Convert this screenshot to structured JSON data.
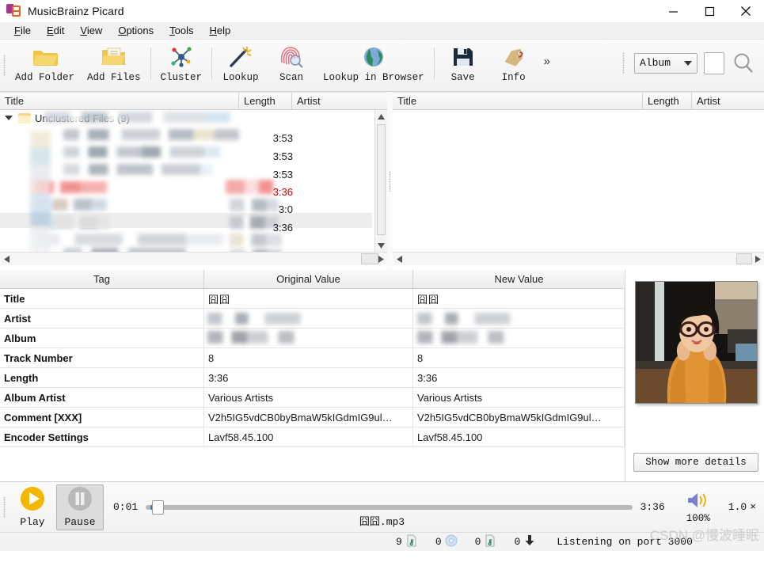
{
  "window": {
    "title": "MusicBrainz Picard",
    "icon": "picard-app-icon",
    "controls": {
      "minimize": "minimize-icon",
      "maximize": "maximize-icon",
      "close": "close-icon"
    }
  },
  "menubar": {
    "items": [
      {
        "label": "File",
        "mnemonic": "F"
      },
      {
        "label": "Edit",
        "mnemonic": "E"
      },
      {
        "label": "View",
        "mnemonic": "V"
      },
      {
        "label": "Options",
        "mnemonic": "O"
      },
      {
        "label": "Tools",
        "mnemonic": "T"
      },
      {
        "label": "Help",
        "mnemonic": "H"
      }
    ]
  },
  "toolbar": {
    "buttons": [
      {
        "label": "Add Folder",
        "icon": "folder-open-icon"
      },
      {
        "label": "Add Files",
        "icon": "file-folder-icon"
      },
      {
        "label": "Cluster",
        "icon": "cluster-network-icon"
      },
      {
        "label": "Lookup",
        "icon": "magic-wand-icon"
      },
      {
        "label": "Scan",
        "icon": "fingerprint-scan-icon"
      },
      {
        "label": "Lookup in Browser",
        "icon": "globe-icon"
      },
      {
        "label": "Save",
        "icon": "floppy-save-icon"
      },
      {
        "label": "Info",
        "icon": "tag-info-icon"
      }
    ],
    "overflow_label": "»",
    "search_type": "Album",
    "search_value": "",
    "search_icon": "search-icon"
  },
  "left_pane": {
    "columns": [
      "Title",
      "Length",
      "Artist"
    ],
    "root_node": {
      "label": "Unclustered Files (9)",
      "expanded": true,
      "icon": "folder-icon"
    },
    "durations": [
      "3:53",
      "3:53",
      "3:53",
      "3:36",
      "3:0",
      "3:36"
    ],
    "duration_error_index": 3,
    "censored": true
  },
  "right_pane": {
    "columns": [
      "Title",
      "Length",
      "Artist"
    ],
    "rows": []
  },
  "tag_table": {
    "headers": [
      "Tag",
      "Original Value",
      "New Value"
    ],
    "rows": [
      {
        "tag": "Title",
        "original": "囧囧",
        "new": "囧囧",
        "censored": false
      },
      {
        "tag": "Artist",
        "original": "",
        "new": "",
        "censored": true
      },
      {
        "tag": "Album",
        "original": "",
        "new": "",
        "censored": true
      },
      {
        "tag": "Track Number",
        "original": "8",
        "new": "8",
        "censored": false
      },
      {
        "tag": "Length",
        "original": "3:36",
        "new": "3:36",
        "censored": false
      },
      {
        "tag": "Album Artist",
        "original": "Various Artists",
        "new": "Various Artists",
        "censored": false
      },
      {
        "tag": "Comment [XXX]",
        "original": "V2h5IG5vdCB0byBmaW5kIGdmIG9ul…",
        "new": "V2h5IG5vdCB0byBmaW5kIGdmIG9ul…",
        "censored": false
      },
      {
        "tag": "Encoder Settings",
        "original": "Lavf58.45.100",
        "new": "Lavf58.45.100",
        "censored": false
      }
    ]
  },
  "cover_art": {
    "name": "album-cover-art",
    "description": "photo of a person wearing an orange sweater and glasses"
  },
  "details_button": {
    "label": "Show more details"
  },
  "player": {
    "play_label": "Play",
    "pause_label": "Pause",
    "play_icon": "play-icon",
    "pause_icon": "pause-icon",
    "elapsed": "0:01",
    "total": "3:36",
    "progress_percent": 0.5,
    "now_playing": "囧囧.mp3",
    "volume_icon": "volume-icon",
    "volume": "100%",
    "rate": "1.0",
    "rate_suffix": "×"
  },
  "statusbar": {
    "counters": [
      {
        "value": "9",
        "icon": "file-note-icon"
      },
      {
        "value": "0",
        "icon": "cd-icon"
      },
      {
        "value": "0",
        "icon": "file-note-icon"
      },
      {
        "value": "0",
        "icon": "download-icon"
      }
    ],
    "message": "Listening on port 3000",
    "watermark": "CSDN @慢波睡眠"
  },
  "colors": {
    "accent_play": "#f3b700",
    "error_red": "#d00000",
    "title_purple": "#a3358a",
    "title_orange": "#e8601d"
  }
}
